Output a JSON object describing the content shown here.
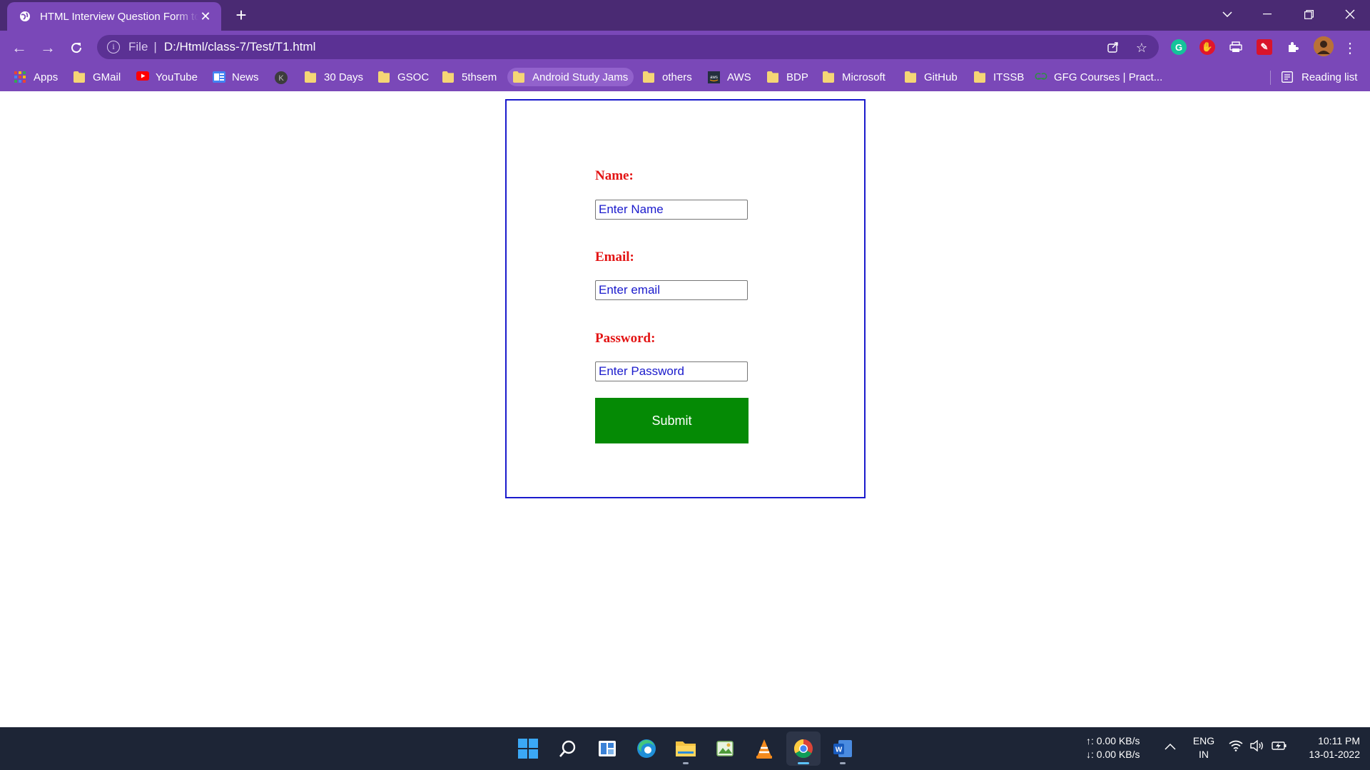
{
  "browser": {
    "tab": {
      "title": "HTML Interview Question Form to..."
    },
    "address": {
      "scheme": "File",
      "url": "D:/Html/class-7/Test/T1.html"
    },
    "reading_list": "Reading list",
    "bookmarks": [
      {
        "label": "Apps",
        "icon": "apps-grid-icon"
      },
      {
        "label": "GMail",
        "icon": "folder-icon"
      },
      {
        "label": "YouTube",
        "icon": "youtube-icon"
      },
      {
        "label": "News",
        "icon": "news-icon"
      },
      {
        "label": "",
        "icon": "k-avatar-icon"
      },
      {
        "label": "30 Days",
        "icon": "folder-icon"
      },
      {
        "label": "GSOC",
        "icon": "folder-icon"
      },
      {
        "label": "5thsem",
        "icon": "folder-icon"
      },
      {
        "label": "Android Study Jams",
        "icon": "folder-icon"
      },
      {
        "label": "others",
        "icon": "folder-icon"
      },
      {
        "label": "AWS",
        "icon": "aws-icon"
      },
      {
        "label": "BDP",
        "icon": "folder-icon"
      },
      {
        "label": "Microsoft",
        "icon": "folder-icon"
      },
      {
        "label": "GitHub",
        "icon": "folder-icon"
      },
      {
        "label": "ITSSB",
        "icon": "folder-icon"
      },
      {
        "label": "GFG Courses | Pract...",
        "icon": "gfg-icon"
      }
    ]
  },
  "form": {
    "name_label": "Name:",
    "name_placeholder": "Enter Name",
    "email_label": "Email:",
    "email_placeholder": "Enter email",
    "password_label": "Password:",
    "password_placeholder": "Enter Password",
    "submit_label": "Submit"
  },
  "taskbar": {
    "net_up": "↑: 0.00 KB/s",
    "net_down": "↓: 0.00 KB/s",
    "lang_1": "ENG",
    "lang_2": "IN",
    "time": "10:11 PM",
    "date": "13-01-2022"
  },
  "colors": {
    "tabbar": "#4a2a73",
    "toolbar": "#7a48b8",
    "label_red": "#e31414",
    "input_text_blue": "#1a1acc",
    "submit_green": "#058a05",
    "taskbar": "#1d2536"
  }
}
